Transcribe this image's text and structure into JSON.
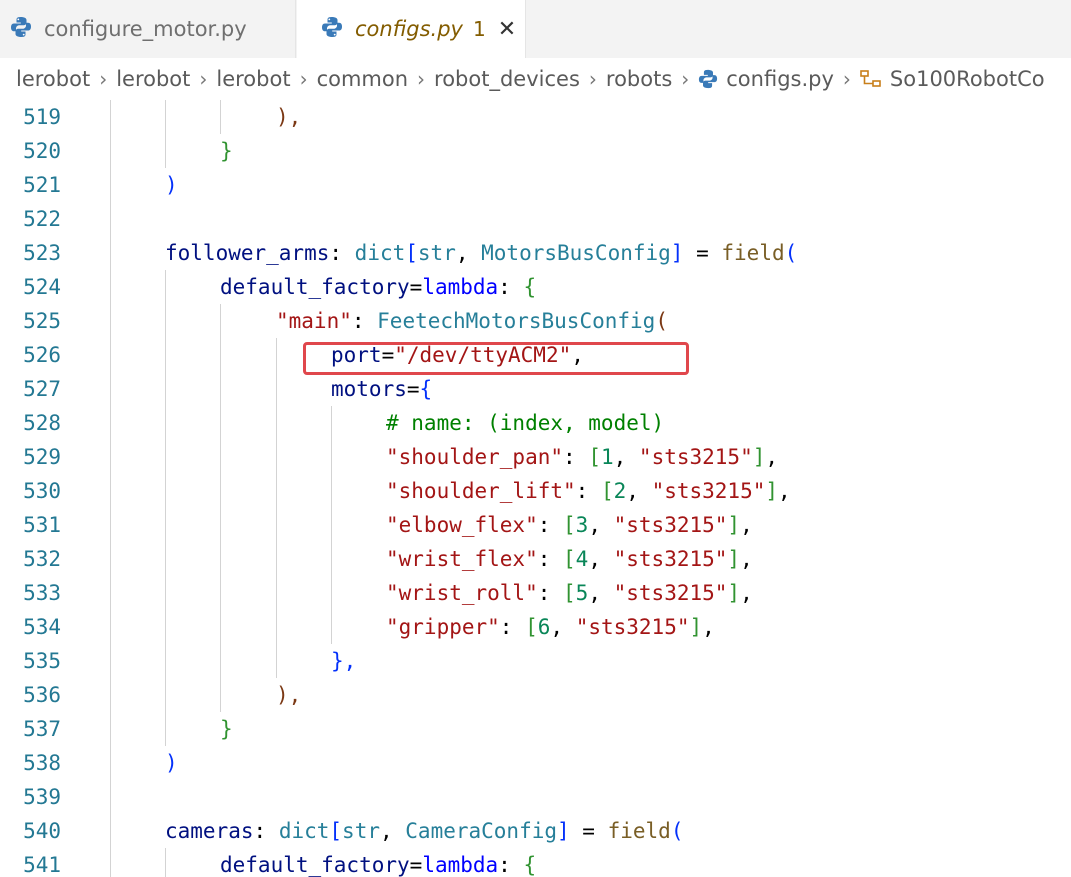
{
  "tabs": [
    {
      "label": "configure_motor.py",
      "icon": "python-icon",
      "active": false
    },
    {
      "label": "configs.py",
      "icon": "python-icon",
      "active": true,
      "problems": "1"
    }
  ],
  "breadcrumbs": [
    "lerobot",
    "lerobot",
    "lerobot",
    "common",
    "robot_devices",
    "robots",
    "configs.py",
    "So100RobotCo"
  ],
  "lines": {
    "l519": {
      "n": "519",
      "c": "),"
    },
    "l520": {
      "n": "520",
      "c": "}"
    },
    "l521": {
      "n": "521",
      "c": ")"
    },
    "l522": {
      "n": "522"
    },
    "l523": {
      "n": "523",
      "name": "follower_arms",
      "type1": "dict",
      "t2": "str",
      "t3": "MotorsBusConfig",
      "fn": "field"
    },
    "l524": {
      "n": "524",
      "kw": "default_factory",
      "lam": "lambda"
    },
    "l525": {
      "n": "525",
      "key": "\"main\"",
      "cls": "FeetechMotorsBusConfig"
    },
    "l526": {
      "n": "526",
      "kw": "port",
      "val": "\"/dev/ttyACM2\""
    },
    "l527": {
      "n": "527",
      "kw": "motors"
    },
    "l528": {
      "n": "528",
      "comment": "# name: (index, model)"
    },
    "l529": {
      "n": "529",
      "key": "\"shoulder_pan\"",
      "idx": "1",
      "model": "\"sts3215\""
    },
    "l530": {
      "n": "530",
      "key": "\"shoulder_lift\"",
      "idx": "2",
      "model": "\"sts3215\""
    },
    "l531": {
      "n": "531",
      "key": "\"elbow_flex\"",
      "idx": "3",
      "model": "\"sts3215\""
    },
    "l532": {
      "n": "532",
      "key": "\"wrist_flex\"",
      "idx": "4",
      "model": "\"sts3215\""
    },
    "l533": {
      "n": "533",
      "key": "\"wrist_roll\"",
      "idx": "5",
      "model": "\"sts3215\""
    },
    "l534": {
      "n": "534",
      "key": "\"gripper\"",
      "idx": "6",
      "model": "\"sts3215\""
    },
    "l535": {
      "n": "535",
      "c": "},"
    },
    "l536": {
      "n": "536",
      "c": "),"
    },
    "l537": {
      "n": "537",
      "c": "}"
    },
    "l538": {
      "n": "538",
      "c": ")"
    },
    "l539": {
      "n": "539"
    },
    "l540": {
      "n": "540",
      "name": "cameras",
      "type1": "dict",
      "t2": "str",
      "t3": "CameraConfig",
      "fn": "field"
    },
    "l541": {
      "n": "541",
      "kw": "default_factory",
      "lam": "lambda"
    }
  },
  "colors": {
    "highlight": "#e0474c",
    "line_number": "#237893"
  }
}
